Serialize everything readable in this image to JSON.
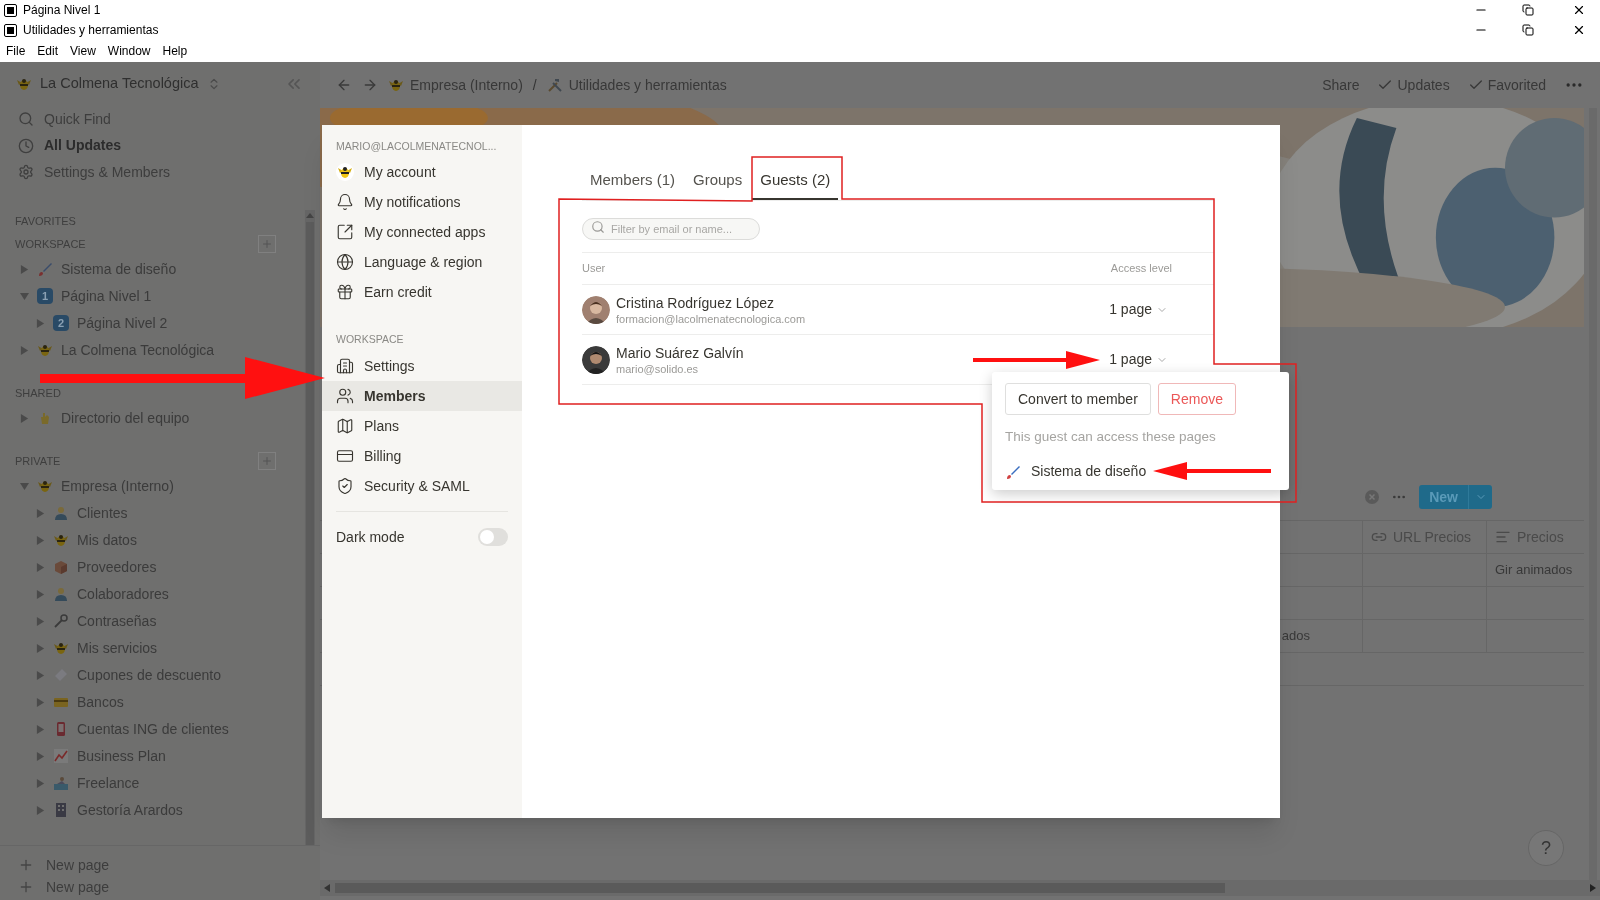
{
  "windows": [
    {
      "title": "Página Nivel 1"
    },
    {
      "title": "Utilidades y herramientas"
    }
  ],
  "menu": [
    "File",
    "Edit",
    "View",
    "Window",
    "Help"
  ],
  "sidebar": {
    "workspace": "La Colmena Tecnológica",
    "nav": [
      {
        "label": "Quick Find",
        "kind": "search",
        "selected": false
      },
      {
        "label": "All Updates",
        "kind": "clock",
        "selected": true
      },
      {
        "label": "Settings & Members",
        "kind": "gear",
        "selected": false
      }
    ],
    "sections": [
      {
        "title": "FAVORITES",
        "add": false
      },
      {
        "title": "WORKSPACE",
        "add": true,
        "pages": [
          {
            "label": "Sistema de diseño",
            "kind": "brush",
            "expanded": false
          },
          {
            "label": "Página Nivel 1",
            "kind": "number",
            "badge": "1",
            "expanded": true,
            "children": [
              {
                "label": "Página Nivel 2",
                "kind": "number",
                "badge": "2",
                "expanded": false
              }
            ]
          },
          {
            "label": "La Colmena Tecnológica",
            "kind": "bee",
            "expanded": false
          }
        ]
      },
      {
        "title": "SHARED",
        "add": false,
        "pages": [
          {
            "label": "Directorio del equipo",
            "kind": "hand",
            "expanded": false
          }
        ]
      },
      {
        "title": "PRIVATE",
        "add": true,
        "pages": [
          {
            "label": "Empresa (Interno)",
            "kind": "bee",
            "expanded": true,
            "children": [
              {
                "label": "Clientes",
                "kind": "person",
                "expanded": false
              },
              {
                "label": "Mis datos",
                "kind": "bee",
                "expanded": false
              },
              {
                "label": "Proveedores",
                "kind": "box",
                "expanded": false
              },
              {
                "label": "Colaboradores",
                "kind": "person",
                "expanded": false
              },
              {
                "label": "Contraseñas",
                "kind": "key",
                "expanded": false
              },
              {
                "label": "Mis servicios",
                "kind": "bee",
                "expanded": false
              },
              {
                "label": "Cupones de descuento",
                "kind": "ticket",
                "expanded": false
              },
              {
                "label": "Bancos",
                "kind": "card",
                "expanded": false
              },
              {
                "label": "Cuentas ING de clientes",
                "kind": "phone",
                "expanded": false
              },
              {
                "label": "Business Plan",
                "kind": "chart",
                "expanded": false
              },
              {
                "label": "Freelance",
                "kind": "surf",
                "expanded": false
              },
              {
                "label": "Gestoría Arardos",
                "kind": "building",
                "expanded": false
              }
            ]
          }
        ]
      }
    ],
    "new_page": [
      "New page",
      "New page"
    ]
  },
  "topbar": {
    "breadcrumbs": [
      {
        "label": "Empresa (Interno)",
        "kind": "bee"
      },
      {
        "label": "Utilidades y herramientas",
        "kind": "tools"
      }
    ],
    "separator": "/",
    "actions": [
      {
        "label": "Share",
        "checked": false
      },
      {
        "label": "Updates",
        "checked": true
      },
      {
        "label": "Favorited",
        "checked": true
      }
    ]
  },
  "database": {
    "new_button": "New",
    "columns": [
      {
        "label": "URL Precios",
        "kind": "link"
      },
      {
        "label": "Precios",
        "kind": "text"
      }
    ],
    "rows": [
      {
        "cells": [
          null,
          null,
          "Gir animados"
        ]
      },
      {
        "cells": [
          null,
          null,
          null
        ]
      },
      {
        "cells": [
          "ados",
          null,
          null
        ]
      }
    ]
  },
  "help": "?",
  "settings": {
    "account_email": "MARIO@LACOLMENATECNOL...",
    "account_items": [
      {
        "label": "My account",
        "kind": "avatar",
        "selected": false
      },
      {
        "label": "My notifications",
        "kind": "bell",
        "selected": false
      },
      {
        "label": "My connected apps",
        "kind": "apps",
        "selected": false
      },
      {
        "label": "Language & region",
        "kind": "globe",
        "selected": false
      },
      {
        "label": "Earn credit",
        "kind": "gift",
        "selected": false
      }
    ],
    "workspace_title": "WORKSPACE",
    "workspace_items": [
      {
        "label": "Settings",
        "kind": "building",
        "selected": false
      },
      {
        "label": "Members",
        "kind": "users",
        "selected": true
      },
      {
        "label": "Plans",
        "kind": "map",
        "selected": false
      },
      {
        "label": "Billing",
        "kind": "card",
        "selected": false
      },
      {
        "label": "Security & SAML",
        "kind": "shield",
        "selected": false
      }
    ],
    "dark_mode": {
      "label": "Dark mode",
      "on": false
    },
    "tabs": [
      {
        "label": "Members (1)",
        "selected": false
      },
      {
        "label": "Groups",
        "selected": false
      },
      {
        "label": "Guests (2)",
        "selected": true
      }
    ],
    "filter": {
      "placeholder": "Filter by email or name..."
    },
    "columns": [
      "User",
      "Access level"
    ],
    "guests": [
      {
        "name": "Cristina Rodríguez López",
        "email": "formacion@lacolmenatecnologica.com",
        "access": "1 page"
      },
      {
        "name": "Mario Suárez Galvín",
        "email": "mario@solido.es",
        "access": "1 page"
      }
    ],
    "popup": {
      "convert": "Convert to member",
      "remove": "Remove",
      "hint": "This guest can access these pages",
      "pages": [
        {
          "label": "Sistema de diseño",
          "kind": "brush"
        }
      ]
    }
  }
}
